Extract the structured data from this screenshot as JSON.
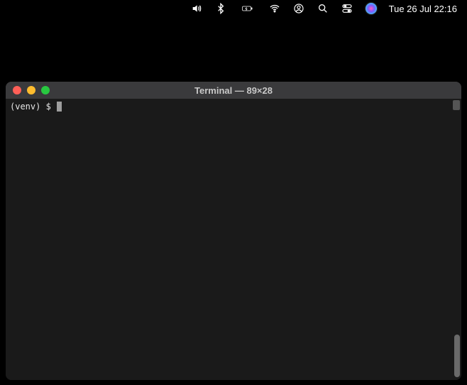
{
  "menubar": {
    "datetime": "Tue 26 Jul  22:16"
  },
  "terminal": {
    "title": "Terminal — 89×28",
    "prompt": "(venv) $ "
  }
}
